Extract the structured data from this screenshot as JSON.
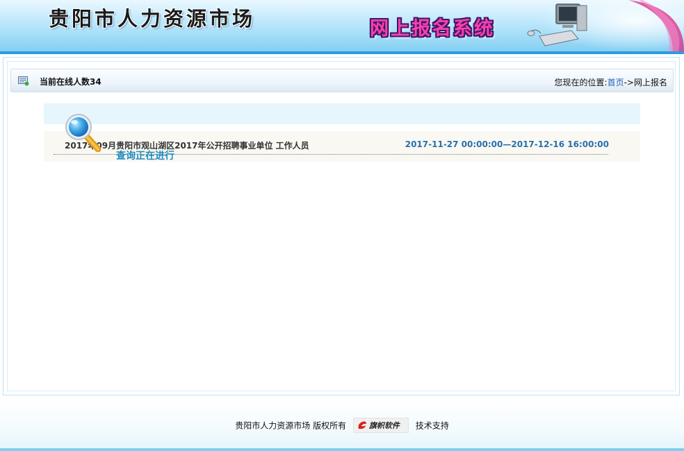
{
  "header": {
    "title": "贵阳市人力资源市场",
    "system_title": "网上报名系统"
  },
  "toolbar": {
    "online_label": "当前在线人数34",
    "location_prefix": "您现在的位置:",
    "home_link": "首页",
    "location_sep": "->",
    "current": "网上报名"
  },
  "listing": {
    "items": [
      {
        "title": "2017年09月贵阳市观山湖区2017年公开招聘事业单位 工作人员",
        "date_range": "2017-11-27 00:00:00—2017-12-16 16:00:00",
        "status": "查询正在进行"
      }
    ]
  },
  "footer": {
    "copyright": "贵阳市人力资源市场 版权所有",
    "vendor_name": "旗帜软件",
    "support": "技术支持"
  },
  "colors": {
    "accent_blue": "#2d9be0",
    "link_blue": "#1f5fb0",
    "date_blue": "#2a6fae",
    "status_blue": "#1f8ac0",
    "system_pink": "#ff3fa9"
  },
  "icons": {
    "online": "online-users-icon",
    "magnifier": "magnifier-icon",
    "computer": "computer-icon",
    "vendor": "vendor-logo-icon"
  }
}
